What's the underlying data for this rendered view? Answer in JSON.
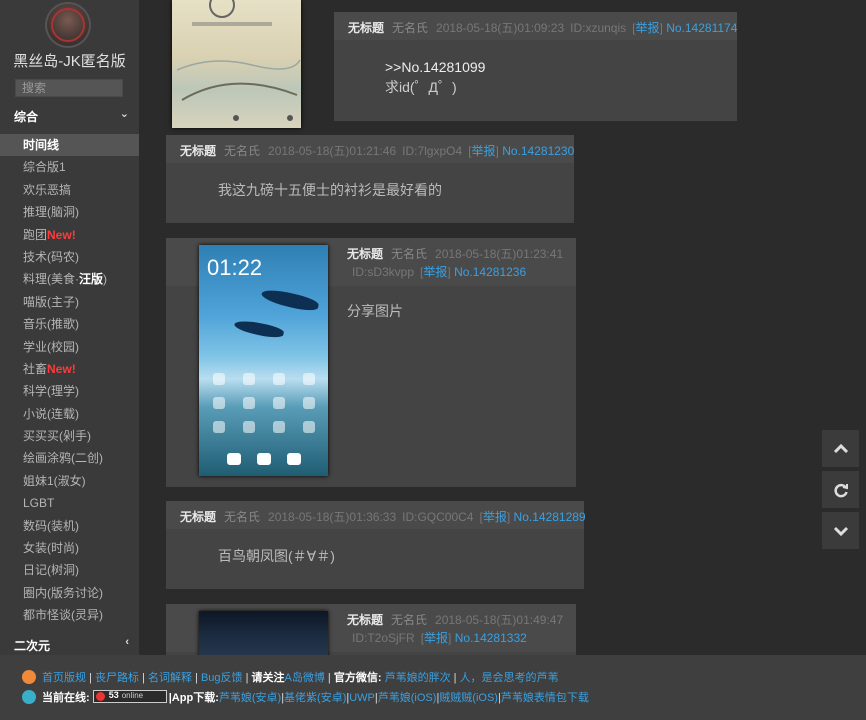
{
  "sidebar": {
    "site_title": "黑丝岛-JK匿名版",
    "search_placeholder": "搜索",
    "category_main": "综合",
    "category_second": "二次元",
    "boards": [
      {
        "label": "时间线",
        "active": true
      },
      {
        "label": "综合版1"
      },
      {
        "label": "欢乐恶搞"
      },
      {
        "label": "推理(脑洞)"
      },
      {
        "label": "跑团",
        "badge": "New!"
      },
      {
        "label": "技术(码农)"
      },
      {
        "label": "料理(美食·",
        "bold_part": "汪版",
        "suffix": ")"
      },
      {
        "label": "喵版(主子)"
      },
      {
        "label": "音乐(推歌)"
      },
      {
        "label": "学业(校园)"
      },
      {
        "label": "社畜",
        "badge": "New!"
      },
      {
        "label": "科学(理学)"
      },
      {
        "label": "小说(连载)"
      },
      {
        "label": "买买买(剁手)"
      },
      {
        "label": "绘画涂鸦(二创)"
      },
      {
        "label": "姐妹1(淑女)"
      },
      {
        "label": "LGBT"
      },
      {
        "label": "数码(装机)"
      },
      {
        "label": "女装(时尚)"
      },
      {
        "label": "日记(树洞)"
      },
      {
        "label": "圈内(版务讨论)"
      },
      {
        "label": "都市怪谈(灵异)"
      }
    ]
  },
  "posts": [
    {
      "title": "无标题",
      "name": "无名氏",
      "time": "2018-05-18(五)01:09:23",
      "uid": "ID:xzunqis",
      "report": "举报",
      "num": "No.14281174",
      "lines": [
        ">>No.14281099",
        "求id(゜Д゜)"
      ]
    },
    {
      "title": "无标题",
      "name": "无名氏",
      "time": "2018-05-18(五)01:21:46",
      "uid": "ID:7lgxpO4",
      "report": "举报",
      "num": "No.14281230",
      "lines": [
        "我这九磅十五便士的衬衫是最好看的"
      ]
    },
    {
      "title": "无标题",
      "name": "无名氏",
      "time": "2018-05-18(五)01:23:41",
      "uid": "ID:sD3kvpp",
      "report": "举报",
      "num": "No.14281236",
      "lines": [
        "分享图片"
      ],
      "image": {
        "clock": "01:22"
      }
    },
    {
      "title": "无标题",
      "name": "无名氏",
      "time": "2018-05-18(五)01:36:33",
      "uid": "ID:GQC00C4",
      "report": "举报",
      "num": "No.14281289",
      "lines": [
        "百鸟朝凤图(＃∀＃)"
      ]
    },
    {
      "title": "无标题",
      "name": "无名氏",
      "time": "2018-05-18(五)01:49:47",
      "uid": "ID:T2oSjFR",
      "report": "举报",
      "num": "No.14281332",
      "lines": []
    }
  ],
  "footer": {
    "links1": [
      "首页版规",
      "丧尸路标",
      "名词解释",
      "Bug反馈"
    ],
    "weibo_prefix": "请关注",
    "weibo_link": "A岛微博",
    "wechat_label": "官方微信:",
    "wechat_links": [
      "芦苇娘的胖次",
      "人，是会思考的芦苇"
    ],
    "online_label": "当前在线:",
    "online_count": "53",
    "online_text": "online",
    "app_label": "|App下载:",
    "app_links": [
      "芦苇娘(安卓)",
      "基佬紫(安卓)",
      "UWP",
      "芦苇娘(iOS)",
      "贼贼贼(iOS)",
      "芦苇娘表情包下载"
    ]
  },
  "icons": [
    "avatar",
    "chevron-down-icon",
    "chevron-left-icon",
    "arrow-up-icon",
    "refresh-icon",
    "arrow-down-icon",
    "mascot-icon"
  ],
  "colors": {
    "link": "#3aa0e0",
    "new_badge": "#ff3b3b",
    "bg": "#2b2b2b",
    "sidebar": "#3a3a3a",
    "post": "#444444"
  }
}
